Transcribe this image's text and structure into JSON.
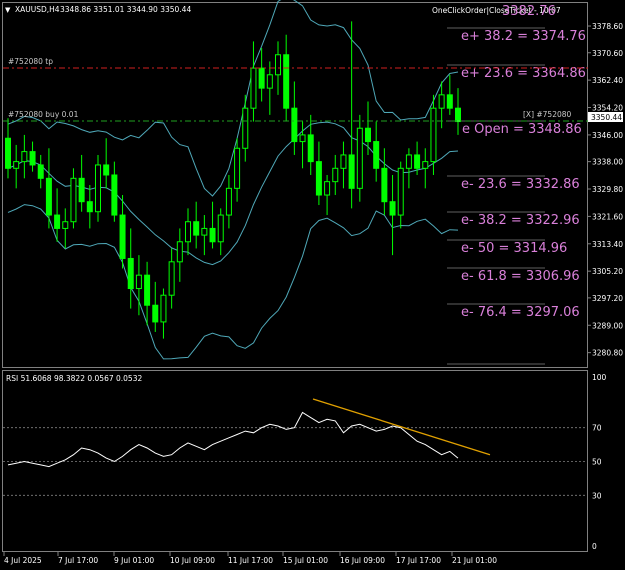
{
  "header": {
    "symbol_label": "XAUUSD,H4",
    "ohlc_label": "3348.86 3351.01 3344.90 3350.44",
    "ea_label": "OneClickOrder|CloseTicket - 10:07",
    "ea_value": "3382.76"
  },
  "price_axis": {
    "ticks": [
      "3378.60",
      "3370.60",
      "3362.40",
      "3354.20",
      "3346.00",
      "3338.00",
      "3329.80",
      "3321.60",
      "3313.40",
      "3305.20",
      "3297.20",
      "3289.00",
      "3280.80"
    ],
    "current_price": "3350.44",
    "colors": {
      "current_bg": "#ffffff",
      "current_fg": "#000000"
    }
  },
  "position_lines": {
    "tp_label": "#752080 tp",
    "buy_label": "#752080 buy 0.01",
    "ticket_label": "[X] #752080",
    "tp_color": "#d02020",
    "buy_color": "#20a020"
  },
  "fib_levels": [
    {
      "label": "e+ 38.2  = 3374.76"
    },
    {
      "label": "e+ 23.6  = 3364.86"
    },
    {
      "label": "e Open  = 3348.86"
    },
    {
      "label": "e- 23.6  = 3332.86"
    },
    {
      "label": "e- 38.2  = 3322.96"
    },
    {
      "label": "e- 50  = 3314.96"
    },
    {
      "label": "e- 61.8  = 3306.96"
    },
    {
      "label": "e- 76.4  = 3297.06"
    }
  ],
  "rsi": {
    "label": "RSI  51.6068 98.3822 0.0567 0.0532",
    "ticks": [
      "100",
      "70",
      "50",
      "30",
      "0"
    ],
    "trendline_color": "#e0a000"
  },
  "time_axis": {
    "ticks": [
      "4 Jul 2025",
      "7 Jul 17:00",
      "9 Jul 01:00",
      "10 Jul 09:00",
      "11 Jul 17:00",
      "15 Jul 01:00",
      "16 Jul 09:00",
      "17 Jul 17:00",
      "21 Jul 01:00"
    ]
  },
  "colors": {
    "background": "#000000",
    "grid": "#808080",
    "candle": "#00ff00",
    "bands": "#4fa8b8",
    "rsi_line": "#ffffff",
    "fib": "#d980d9"
  },
  "chart_data": {
    "type": "candlestick",
    "symbol": "XAUUSD",
    "timeframe": "H4",
    "ylim": [
      3278,
      3384
    ],
    "candles": [
      {
        "o": 3345,
        "h": 3351,
        "l": 3333,
        "c": 3336
      },
      {
        "o": 3336,
        "h": 3343,
        "l": 3330,
        "c": 3338
      },
      {
        "o": 3338,
        "h": 3346,
        "l": 3333,
        "c": 3341
      },
      {
        "o": 3341,
        "h": 3344,
        "l": 3335,
        "c": 3337
      },
      {
        "o": 3337,
        "h": 3340,
        "l": 3330,
        "c": 3333
      },
      {
        "o": 3333,
        "h": 3342,
        "l": 3318,
        "c": 3322
      },
      {
        "o": 3322,
        "h": 3330,
        "l": 3314,
        "c": 3318
      },
      {
        "o": 3318,
        "h": 3324,
        "l": 3312,
        "c": 3320
      },
      {
        "o": 3320,
        "h": 3336,
        "l": 3318,
        "c": 3333
      },
      {
        "o": 3333,
        "h": 3340,
        "l": 3323,
        "c": 3326
      },
      {
        "o": 3326,
        "h": 3331,
        "l": 3318,
        "c": 3323
      },
      {
        "o": 3323,
        "h": 3340,
        "l": 3320,
        "c": 3337
      },
      {
        "o": 3337,
        "h": 3345,
        "l": 3330,
        "c": 3334
      },
      {
        "o": 3334,
        "h": 3338,
        "l": 3320,
        "c": 3322
      },
      {
        "o": 3322,
        "h": 3328,
        "l": 3306,
        "c": 3309
      },
      {
        "o": 3309,
        "h": 3318,
        "l": 3294,
        "c": 3300
      },
      {
        "o": 3300,
        "h": 3310,
        "l": 3292,
        "c": 3304
      },
      {
        "o": 3304,
        "h": 3308,
        "l": 3289,
        "c": 3295
      },
      {
        "o": 3295,
        "h": 3302,
        "l": 3287,
        "c": 3290
      },
      {
        "o": 3290,
        "h": 3300,
        "l": 3285,
        "c": 3298
      },
      {
        "o": 3298,
        "h": 3312,
        "l": 3294,
        "c": 3308
      },
      {
        "o": 3308,
        "h": 3318,
        "l": 3302,
        "c": 3314
      },
      {
        "o": 3314,
        "h": 3324,
        "l": 3310,
        "c": 3320
      },
      {
        "o": 3320,
        "h": 3326,
        "l": 3312,
        "c": 3316
      },
      {
        "o": 3316,
        "h": 3322,
        "l": 3310,
        "c": 3318
      },
      {
        "o": 3318,
        "h": 3326,
        "l": 3312,
        "c": 3314
      },
      {
        "o": 3314,
        "h": 3324,
        "l": 3310,
        "c": 3322
      },
      {
        "o": 3322,
        "h": 3334,
        "l": 3318,
        "c": 3330
      },
      {
        "o": 3330,
        "h": 3345,
        "l": 3326,
        "c": 3342
      },
      {
        "o": 3342,
        "h": 3358,
        "l": 3338,
        "c": 3354
      },
      {
        "o": 3354,
        "h": 3374,
        "l": 3350,
        "c": 3366
      },
      {
        "o": 3366,
        "h": 3372,
        "l": 3356,
        "c": 3360
      },
      {
        "o": 3360,
        "h": 3368,
        "l": 3352,
        "c": 3364
      },
      {
        "o": 3364,
        "h": 3374,
        "l": 3358,
        "c": 3370
      },
      {
        "o": 3370,
        "h": 3376,
        "l": 3350,
        "c": 3354
      },
      {
        "o": 3354,
        "h": 3362,
        "l": 3340,
        "c": 3344
      },
      {
        "o": 3344,
        "h": 3350,
        "l": 3336,
        "c": 3346
      },
      {
        "o": 3346,
        "h": 3352,
        "l": 3334,
        "c": 3338
      },
      {
        "o": 3338,
        "h": 3344,
        "l": 3325,
        "c": 3328
      },
      {
        "o": 3328,
        "h": 3334,
        "l": 3322,
        "c": 3332
      },
      {
        "o": 3332,
        "h": 3340,
        "l": 3328,
        "c": 3336
      },
      {
        "o": 3336,
        "h": 3344,
        "l": 3330,
        "c": 3340
      },
      {
        "o": 3340,
        "h": 3380,
        "l": 3324,
        "c": 3330
      },
      {
        "o": 3330,
        "h": 3352,
        "l": 3326,
        "c": 3348
      },
      {
        "o": 3348,
        "h": 3356,
        "l": 3340,
        "c": 3344
      },
      {
        "o": 3344,
        "h": 3350,
        "l": 3332,
        "c": 3336
      },
      {
        "o": 3336,
        "h": 3342,
        "l": 3322,
        "c": 3326
      },
      {
        "o": 3326,
        "h": 3334,
        "l": 3310,
        "c": 3322
      },
      {
        "o": 3322,
        "h": 3338,
        "l": 3318,
        "c": 3336
      },
      {
        "o": 3336,
        "h": 3342,
        "l": 3330,
        "c": 3340
      },
      {
        "o": 3340,
        "h": 3344,
        "l": 3334,
        "c": 3336
      },
      {
        "o": 3336,
        "h": 3342,
        "l": 3330,
        "c": 3338
      },
      {
        "o": 3338,
        "h": 3358,
        "l": 3334,
        "c": 3354
      },
      {
        "o": 3354,
        "h": 3362,
        "l": 3348,
        "c": 3358
      },
      {
        "o": 3358,
        "h": 3364,
        "l": 3352,
        "c": 3354
      },
      {
        "o": 3354,
        "h": 3360,
        "l": 3346,
        "c": 3350
      }
    ],
    "rsi_values": [
      48,
      49,
      50,
      49,
      48,
      47,
      49,
      51,
      54,
      58,
      57,
      55,
      52,
      50,
      53,
      57,
      60,
      58,
      55,
      53,
      54,
      58,
      61,
      59,
      57,
      60,
      62,
      64,
      66,
      68,
      67,
      70,
      72,
      71,
      69,
      70,
      79,
      76,
      73,
      75,
      74,
      67,
      71,
      72,
      70,
      68,
      69,
      71,
      70,
      66,
      62,
      60,
      57,
      54,
      56,
      52
    ]
  }
}
